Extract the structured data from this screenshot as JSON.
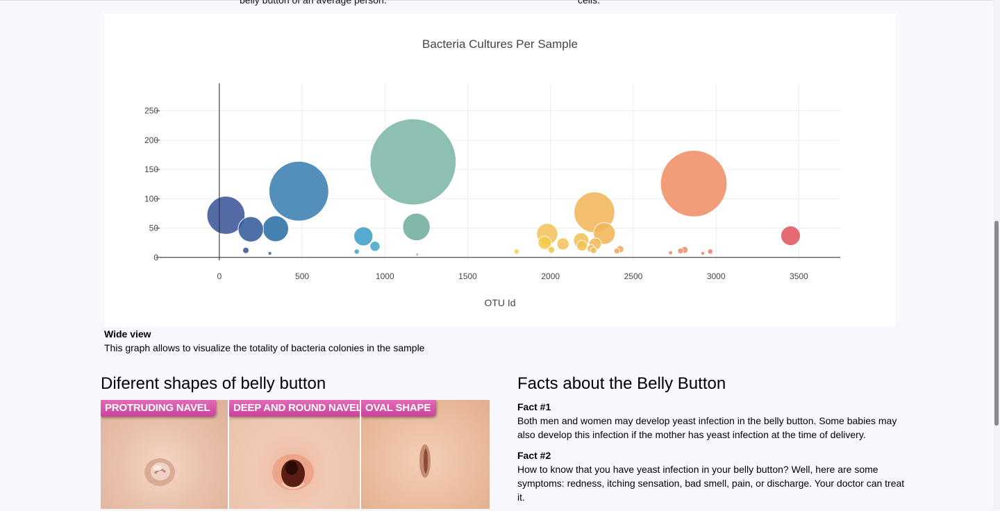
{
  "top_cut": {
    "left_text": "belly button of an average person.",
    "right_text": "cells."
  },
  "chart_data": {
    "type": "scatter",
    "title": "Bacteria Cultures Per Sample",
    "xlabel": "OTU Id",
    "ylabel": "",
    "xlim": [
      -360,
      3750
    ],
    "ylim": [
      -5,
      297
    ],
    "x_ticks": [
      "0",
      "500",
      "1000",
      "1500",
      "2000",
      "2500",
      "3000",
      "3500"
    ],
    "y_ticks": [
      "0",
      "50",
      "100",
      "150",
      "200",
      "250"
    ],
    "grid": true,
    "colorscale": "Earth",
    "points": [
      {
        "x": 40,
        "y": 72,
        "color": "#3c5799"
      },
      {
        "x": 190,
        "y": 48,
        "color": "#345d9b"
      },
      {
        "x": 340,
        "y": 49,
        "color": "#2e6fa6"
      },
      {
        "x": 480,
        "y": 113,
        "color": "#3b7fb0"
      },
      {
        "x": 160,
        "y": 12,
        "color": "#3c5799"
      },
      {
        "x": 305,
        "y": 7,
        "color": "#2e6fa6"
      },
      {
        "x": 870,
        "y": 36,
        "color": "#3f9ec6"
      },
      {
        "x": 940,
        "y": 19,
        "color": "#45a7c8"
      },
      {
        "x": 830,
        "y": 10,
        "color": "#4aa8c9"
      },
      {
        "x": 1170,
        "y": 163,
        "color": "#7db6a8"
      },
      {
        "x": 1190,
        "y": 52,
        "color": "#6fae9d"
      },
      {
        "x": 1195,
        "y": 5,
        "color": "#6fae9d"
      },
      {
        "x": 1795,
        "y": 10,
        "color": "#f0d05c"
      },
      {
        "x": 1980,
        "y": 40,
        "color": "#f4c25c"
      },
      {
        "x": 1965,
        "y": 25,
        "color": "#f6c84a"
      },
      {
        "x": 2005,
        "y": 13,
        "color": "#f6c84a"
      },
      {
        "x": 2075,
        "y": 23,
        "color": "#f4c25c"
      },
      {
        "x": 2265,
        "y": 77,
        "color": "#f1b55a"
      },
      {
        "x": 2325,
        "y": 41,
        "color": "#f1b55a"
      },
      {
        "x": 2185,
        "y": 29,
        "color": "#f5c058"
      },
      {
        "x": 2190,
        "y": 20,
        "color": "#f5c058"
      },
      {
        "x": 2270,
        "y": 23,
        "color": "#f4b85c"
      },
      {
        "x": 2245,
        "y": 15,
        "color": "#f4b85c"
      },
      {
        "x": 2260,
        "y": 12,
        "color": "#f4b85c"
      },
      {
        "x": 2420,
        "y": 14,
        "color": "#f0a860"
      },
      {
        "x": 2400,
        "y": 11,
        "color": "#f0a860"
      },
      {
        "x": 2865,
        "y": 126,
        "color": "#ef8f68"
      },
      {
        "x": 2810,
        "y": 13,
        "color": "#ef8f68"
      },
      {
        "x": 2785,
        "y": 11,
        "color": "#ef8f68"
      },
      {
        "x": 2725,
        "y": 8,
        "color": "#ef8f68"
      },
      {
        "x": 2965,
        "y": 10,
        "color": "#ee7d6a"
      },
      {
        "x": 2920,
        "y": 7,
        "color": "#ee7d6a"
      },
      {
        "x": 3450,
        "y": 37,
        "color": "#e35560"
      }
    ]
  },
  "wide_view": {
    "title": "Wide view",
    "description": "This graph allows to visualize the totality of bacteria colonies in the sample"
  },
  "shapes": {
    "heading": "Diferent shapes of belly button",
    "panels": [
      "PROTRUDING NAVEL",
      "DEEP AND ROUND NAVEL",
      "OVAL SHAPE"
    ]
  },
  "facts": {
    "heading": "Facts about the Belly Button",
    "items": [
      {
        "title": "Fact #1",
        "body": "Both men and women may develop yeast infection in the belly button. Some babies may also develop this infection if the mother has yeast infection at the time of delivery."
      },
      {
        "title": "Fact #2",
        "body": "How to know that you have yeast infection in your belly button? Well, here are some symptoms: redness, itching sensation, bad smell, pain, or discharge. Your doctor can treat it."
      }
    ]
  }
}
